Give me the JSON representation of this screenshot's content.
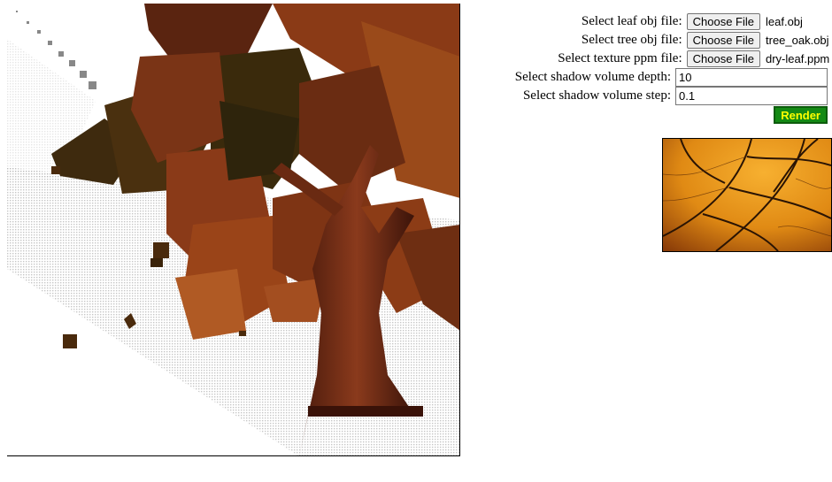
{
  "form": {
    "leaf": {
      "label": "Select leaf obj file:",
      "button": "Choose File",
      "file": "leaf.obj"
    },
    "tree": {
      "label": "Select tree obj file:",
      "button": "Choose File",
      "file": "tree_oak.obj"
    },
    "texture": {
      "label": "Select texture ppm file:",
      "button": "Choose File",
      "file": "dry-leaf.ppm"
    },
    "depth": {
      "label": "Select shadow volume depth:",
      "value": "10"
    },
    "step": {
      "label": "Select shadow volume step:",
      "value": "0.1"
    },
    "render_label": "Render"
  },
  "colors": {
    "render_button_bg": "#148a14",
    "render_button_text": "#ffff00",
    "leaf_dark": "#3a2408",
    "leaf_mid": "#7a3413",
    "leaf_light": "#b85a22",
    "texture_orange": "#e8901a"
  }
}
